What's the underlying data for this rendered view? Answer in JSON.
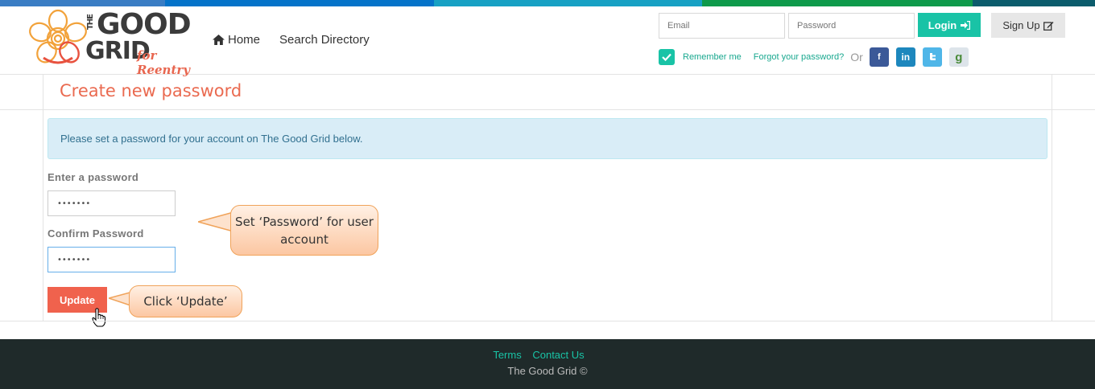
{
  "colors": {
    "strip": [
      "#3a7dc4",
      "#0573c9",
      "#17a1c4",
      "#0f9a4b",
      "#0c5c6c"
    ],
    "accent": "#19c3a6",
    "title": "#ea6a50",
    "update_button": "#f0624d",
    "footer_bg": "#1f2a2a"
  },
  "logo": {
    "the": "THE",
    "good": "GOOD",
    "grid": "GRID",
    "tagline": "for Reentry"
  },
  "nav": {
    "home": "Home",
    "search": "Search Directory"
  },
  "login": {
    "email_placeholder": "Email",
    "password_placeholder": "Password",
    "login_label": "Login",
    "signup_label": "Sign Up",
    "remember_label": "Remember me",
    "forgot_label": "Forgot your password?",
    "or": "Or",
    "social_icons": [
      "facebook-icon",
      "linkedin-icon",
      "twitter-icon",
      "google-icon"
    ]
  },
  "main": {
    "title": "Create new password",
    "alert": "Please set a password for your account on The Good Grid below.",
    "password_label": "Enter a password",
    "password_value": "•••••••",
    "confirm_label": "Confirm Password",
    "confirm_value": "•••••••",
    "update_label": "Update"
  },
  "callouts": {
    "password": "Set ‘Password’ for user account",
    "update": "Click ‘Update’"
  },
  "footer": {
    "terms": "Terms",
    "contact": "Contact Us",
    "copyright": "The Good Grid ©"
  }
}
